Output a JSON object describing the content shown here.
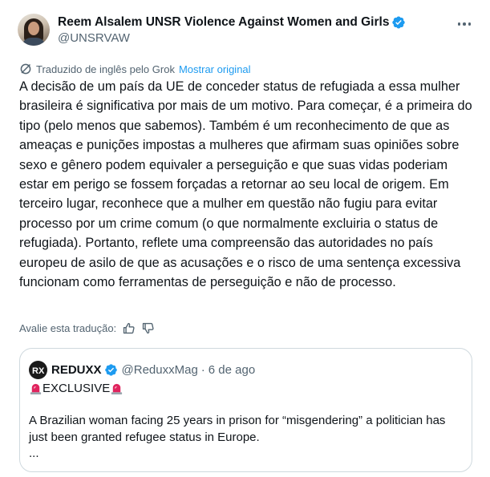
{
  "author": {
    "display_name": "Reem Alsalem UNSR Violence Against Women and Girls",
    "handle": "@UNSRVAW",
    "verified": true,
    "avatar_icon": "profile-photo"
  },
  "translation": {
    "note": "Traduzido de inglês pelo Grok",
    "show_original": "Mostrar original"
  },
  "post": {
    "text": "A decisão de um país da UE de conceder status de refugiada a essa mulher brasileira é significativa por mais de um motivo. Para começar, é a primeira do tipo (pelo menos que sabemos). Também é um reconhecimento de que as ameaças e punições impostas a mulheres que afirmam suas opiniões sobre sexo e gênero podem equivaler a perseguição e que suas vidas poderiam estar em perigo se fossem forçadas a retornar ao seu local de origem. Em terceiro lugar, reconhece que a mulher em questão não fugiu para evitar processo por um crime comum (o que normalmente excluiria o status de refugiada). Portanto, reflete uma compreensão das autoridades no país europeu de asilo de que as acusações e o risco de uma sentença excessiva funcionam como ferramentas de perseguição e não de processo."
  },
  "rating": {
    "label": "Avalie esta tradução:"
  },
  "quote": {
    "name": "REDUXX",
    "handle": "@ReduxxMag",
    "separator": "·",
    "date": "6 de ago",
    "verified": true,
    "exclusive_label": "EXCLUSIVE",
    "text": "A Brazilian woman facing 25 years in prison for “misgendering” a politician has just been granted refugee status in Europe.",
    "ellipsis": "..."
  },
  "colors": {
    "text": "#0f1419",
    "secondary": "#536471",
    "link": "#1d9bf0",
    "border": "#cfd9de",
    "verified": "#1d9bf0",
    "siren": "#e0245e"
  }
}
